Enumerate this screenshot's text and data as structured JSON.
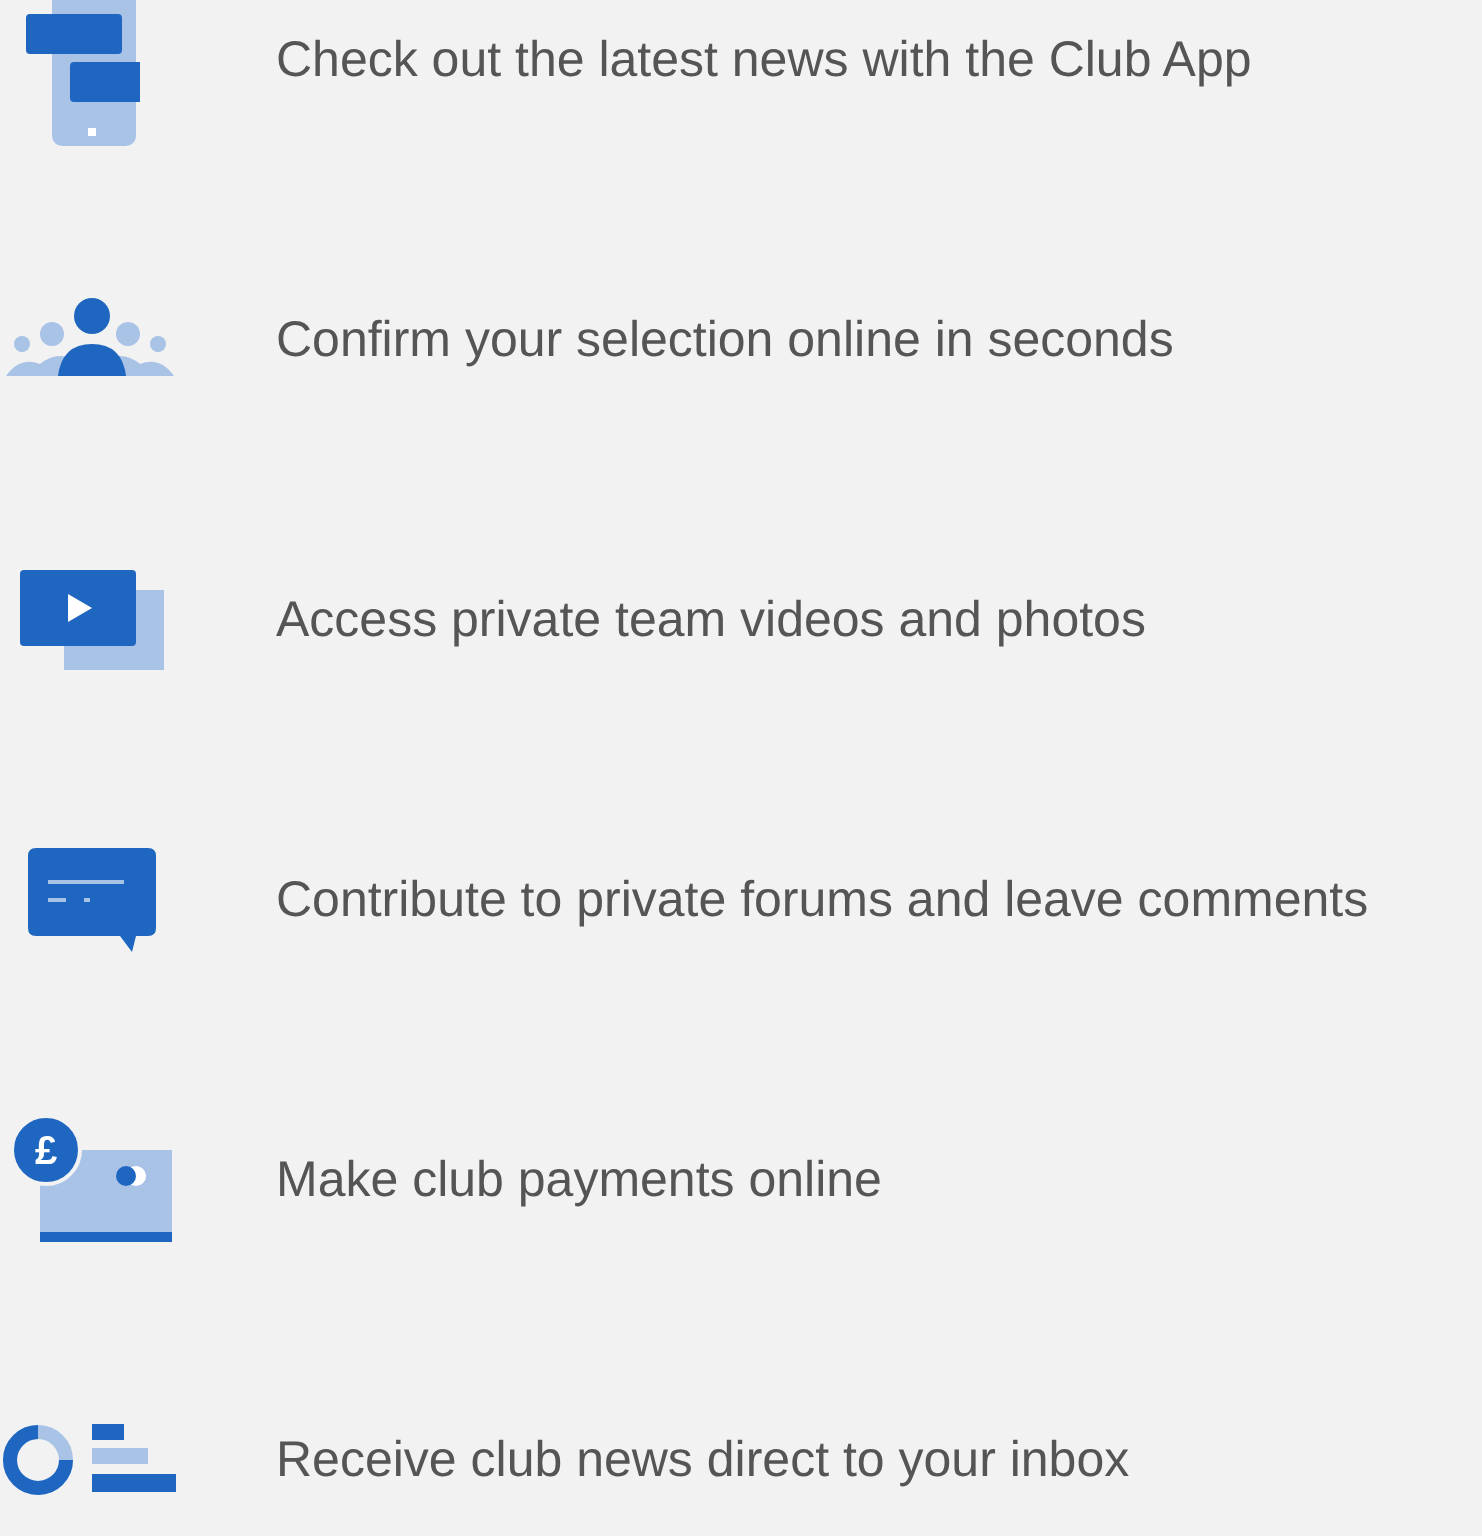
{
  "features": [
    {
      "kind": "phone",
      "text": "Check out the latest news with the Club App"
    },
    {
      "kind": "people",
      "text": "Confirm your selection online in seconds"
    },
    {
      "kind": "video",
      "text": "Access private team videos and photos"
    },
    {
      "kind": "chat",
      "text": "Contribute to private forums and leave comments"
    },
    {
      "kind": "payment",
      "text": "Make club payments online",
      "icon_symbol": "£"
    },
    {
      "kind": "newsletter",
      "text": "Receive club news direct to your inbox"
    }
  ]
}
